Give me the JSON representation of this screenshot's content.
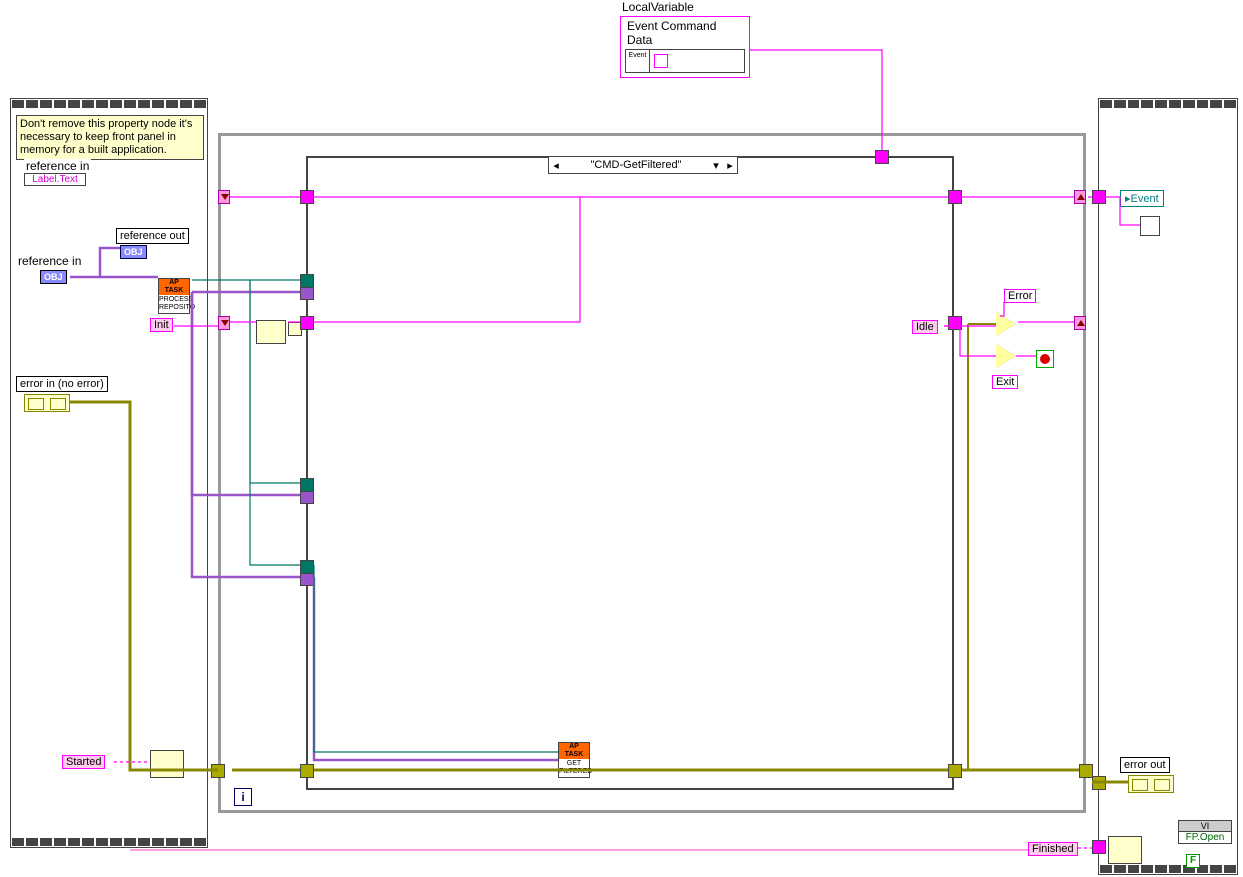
{
  "localvar": {
    "title": "LocalVariable",
    "name": "Event Command Data",
    "icon_text": "Event"
  },
  "note": "Don't remove this property node it's necessary to keep front panel in memory for a built application.",
  "propnode": {
    "hdr": "reference in",
    "row": "Label.Text"
  },
  "terminals": {
    "reference_in": "reference in",
    "reference_out": "reference out",
    "error_in": "error in (no error)",
    "error_out": "error out",
    "event_out": "Event",
    "obj": "OBJ"
  },
  "strings": {
    "init": "Init",
    "started": "Started",
    "finished": "Finished",
    "idle": "Idle",
    "error": "Error",
    "exit": "Exit"
  },
  "case_selector": "\"CMD-GetFiltered\"",
  "subvis": {
    "process_repo": {
      "hdr": "AP TASK",
      "txt": "PROCESS\nREPOSITO"
    },
    "get_filtered": {
      "hdr": "AP TASK",
      "txt": "GET\nFILTERED"
    }
  },
  "propnode2": {
    "hdr": "VI",
    "row": "FP.Open"
  },
  "iter": "i",
  "bool_false": "F"
}
